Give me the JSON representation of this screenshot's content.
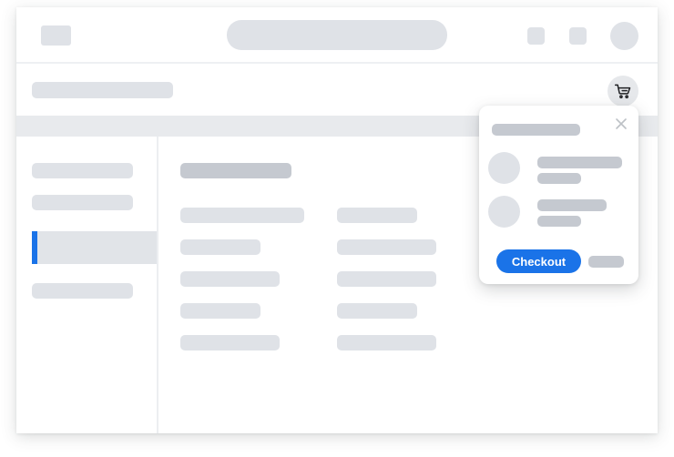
{
  "cart_popover": {
    "checkout_label": "Checkout"
  },
  "icons": {
    "cart": "shopping-cart-icon",
    "close": "close-icon"
  },
  "colors": {
    "accent": "#1a73e8",
    "placeholder": "#dfe2e7",
    "placeholder_dark": "#c5c9d0"
  }
}
